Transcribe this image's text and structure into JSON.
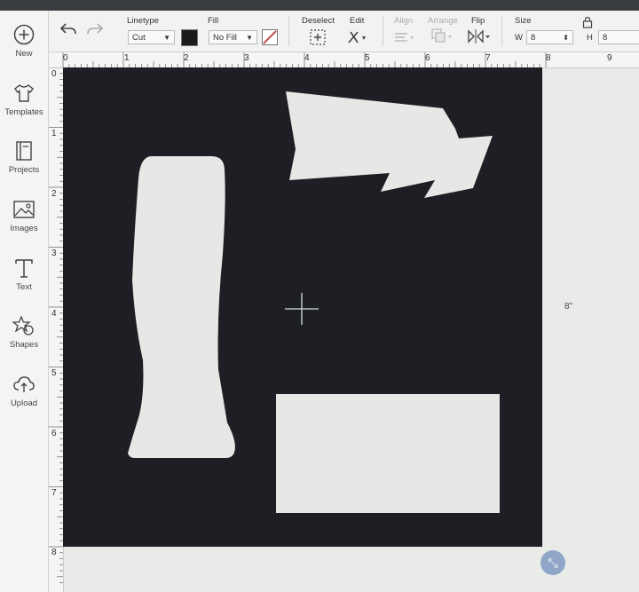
{
  "sidebar": {
    "items": [
      {
        "label": "New",
        "icon": "plus-circle-icon"
      },
      {
        "label": "Templates",
        "icon": "shirt-icon"
      },
      {
        "label": "Projects",
        "icon": "book-icon"
      },
      {
        "label": "Images",
        "icon": "image-icon"
      },
      {
        "label": "Text",
        "icon": "text-t-icon"
      },
      {
        "label": "Shapes",
        "icon": "shapes-icon"
      },
      {
        "label": "Upload",
        "icon": "cloud-upload-icon"
      }
    ]
  },
  "toolbar": {
    "linetype_label": "Linetype",
    "linetype_value": "Cut",
    "fill_label": "Fill",
    "fill_value": "No Fill",
    "fill_color": "#1b1b1b",
    "deselect_label": "Deselect",
    "edit_label": "Edit",
    "align_label": "Align",
    "arrange_label": "Arrange",
    "flip_label": "Flip",
    "size_label": "Size",
    "width_label": "W",
    "width_value": "8",
    "height_label": "H",
    "height_value": "8"
  },
  "rulers": {
    "top": [
      "0",
      "1",
      "2",
      "3",
      "4",
      "5",
      "6",
      "7",
      "8",
      "9"
    ],
    "left": [
      "0",
      "1",
      "2",
      "3",
      "4",
      "5",
      "6",
      "7",
      "8"
    ]
  },
  "canvas": {
    "size_readout": "8\"",
    "mat_color": "#1d1f24",
    "shape_color": "#e6e8e5"
  }
}
